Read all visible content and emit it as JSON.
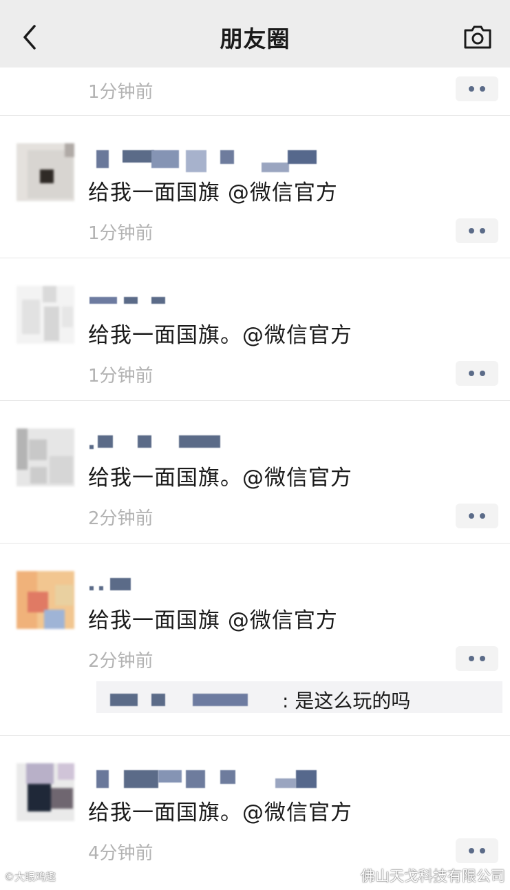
{
  "header": {
    "title": "朋友圈",
    "back_icon": "chevron-left-icon",
    "camera_icon": "camera-icon"
  },
  "posts": [
    {
      "text": "",
      "time": "1分钟前"
    },
    {
      "text": "给我一面国旗 @微信官方",
      "time": "1分钟前"
    },
    {
      "text": "给我一面国旗。@微信官方",
      "time": "1分钟前"
    },
    {
      "text": "给我一面国旗。@微信官方",
      "time": "2分钟前"
    },
    {
      "text": "给我一面国旗 @微信官方",
      "time": "2分钟前",
      "comment": ": 是这么玩的吗"
    },
    {
      "text": "给我一面国旗。@微信官方",
      "time": "4分钟前"
    }
  ],
  "watermarks": {
    "left": "©大眼鸡趣",
    "right": "佛山天戈科技有限公司"
  },
  "colors": {
    "header_bg": "#ededed",
    "name_blue": "#5b6b88",
    "time_gray": "#b2b2b2"
  }
}
